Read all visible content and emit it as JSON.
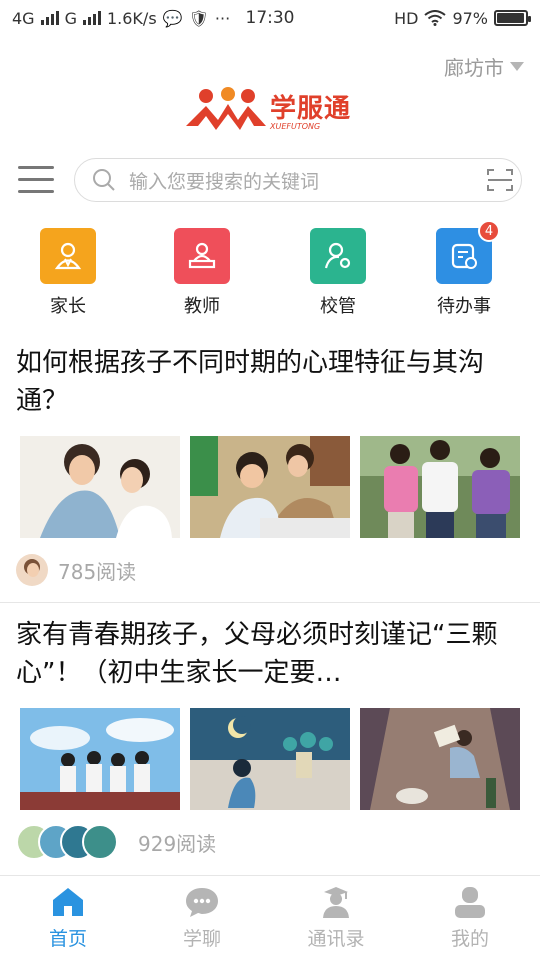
{
  "status": {
    "network1": "4G",
    "network2": "G",
    "speed": "1.6K/s",
    "time": "17:30",
    "hd": "HD",
    "battery": "97%",
    "battery_level": 0.97
  },
  "header": {
    "city": "廊坊市",
    "logo_text": "学服通",
    "logo_sub": "XUEFUTONG"
  },
  "search": {
    "placeholder": "输入您要搜索的关键词"
  },
  "quick": [
    {
      "label": "家长",
      "color": "#f5a41d",
      "icon": "parent-icon"
    },
    {
      "label": "教师",
      "color": "#ef4f5a",
      "icon": "teacher-icon"
    },
    {
      "label": "校管",
      "color": "#2bb48f",
      "icon": "school-admin-icon"
    },
    {
      "label": "待办事",
      "color": "#2e8fe3",
      "icon": "todo-icon",
      "badge": "4"
    }
  ],
  "articles": [
    {
      "title": "如何根据孩子不同时期的心理特征与其沟通？",
      "reads": "785阅读"
    },
    {
      "title": "家有青春期孩子，父母必须时刻谨记“三颗心”！（初中生家长一定要…",
      "reads": "929阅读"
    }
  ],
  "tabs": [
    {
      "label": "首页",
      "icon": "home-icon"
    },
    {
      "label": "学聊",
      "icon": "chat-icon"
    },
    {
      "label": "通讯录",
      "icon": "contacts-icon"
    },
    {
      "label": "我的",
      "icon": "profile-icon"
    }
  ],
  "colors": {
    "accent": "#2a93e0",
    "brand": "#e0402b",
    "badge": "#e74c3c"
  }
}
